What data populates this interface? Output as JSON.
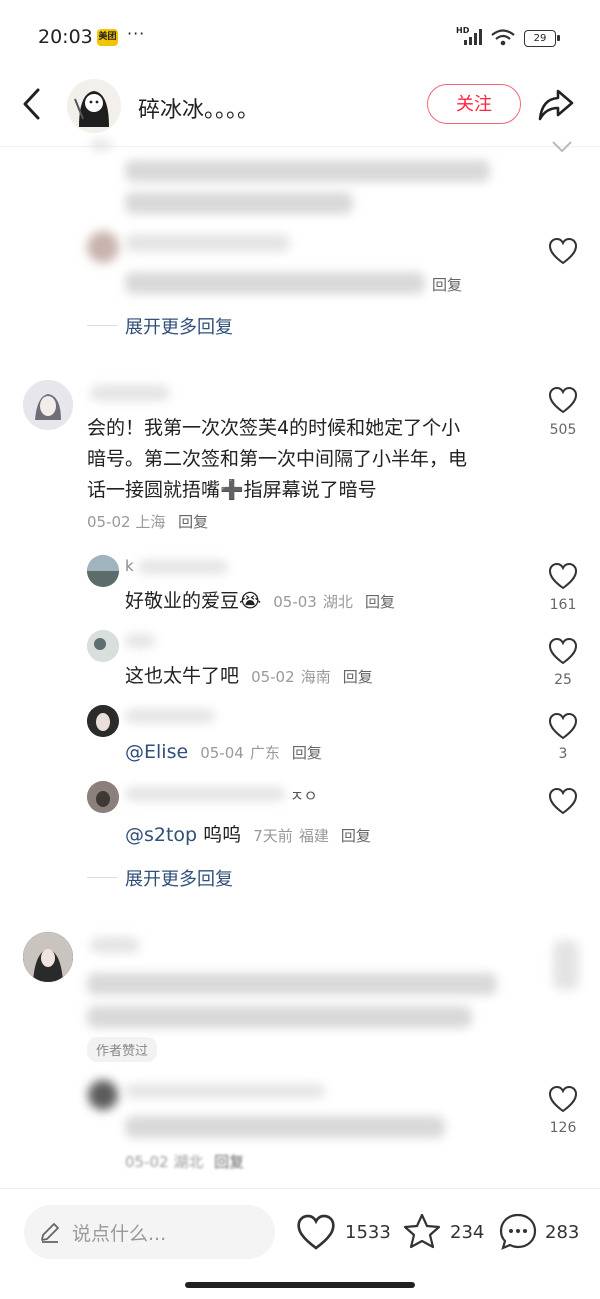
{
  "status_bar": {
    "time": "20:03",
    "app_badge": "美团",
    "dots": "···",
    "network": "HD",
    "battery": "29"
  },
  "header": {
    "author_name": "碎冰冰。。。。",
    "follow_label": "关注",
    "icons": [
      "back-icon",
      "share-icon"
    ]
  },
  "comments": {
    "top_thread": {
      "reply_label": "回复",
      "expand_label": "展开更多回复"
    },
    "main": {
      "text_line1": "会的！我第一次次签芙4的时候和她定了个小",
      "text_line2": "暗号。第二次签和第一次中间隔了小半年，电",
      "text_line3": "话一接圆就捂嘴➕指屏幕说了暗号",
      "date": "05-02",
      "location": "上海",
      "reply_label": "回复",
      "likes": "505",
      "replies": [
        {
          "text": "好敬业的爱豆",
          "emoji": "😭",
          "date": "05-03",
          "location": "湖北",
          "reply_label": "回复",
          "likes": "161",
          "name_prefix": "k"
        },
        {
          "text": "这也太牛了吧",
          "date": "05-02",
          "location": "海南",
          "reply_label": "回复",
          "likes": "25"
        },
        {
          "mention": "@Elise",
          "date": "05-04",
          "location": "广东",
          "reply_label": "回复",
          "likes": "3"
        },
        {
          "name_suffix": "ㅈㅇ",
          "mention": "@s2top",
          "text": "呜呜",
          "date": "7天前",
          "location": "福建",
          "reply_label": "回复",
          "likes": ""
        }
      ],
      "expand_label": "展开更多回复"
    },
    "third": {
      "author_badge": "作者赞过",
      "reply_likes": "126",
      "reply_date": "05-02",
      "reply_location": "湖北",
      "reply_label": "回复"
    }
  },
  "bottom_bar": {
    "input_placeholder": "说点什么...",
    "likes": "1533",
    "stars": "234",
    "comments": "283",
    "icons": [
      "pencil-icon",
      "heart-icon",
      "star-icon",
      "chat-icon"
    ]
  },
  "colors": {
    "accent_red": "#ff2442",
    "link_blue": "#30507a"
  }
}
